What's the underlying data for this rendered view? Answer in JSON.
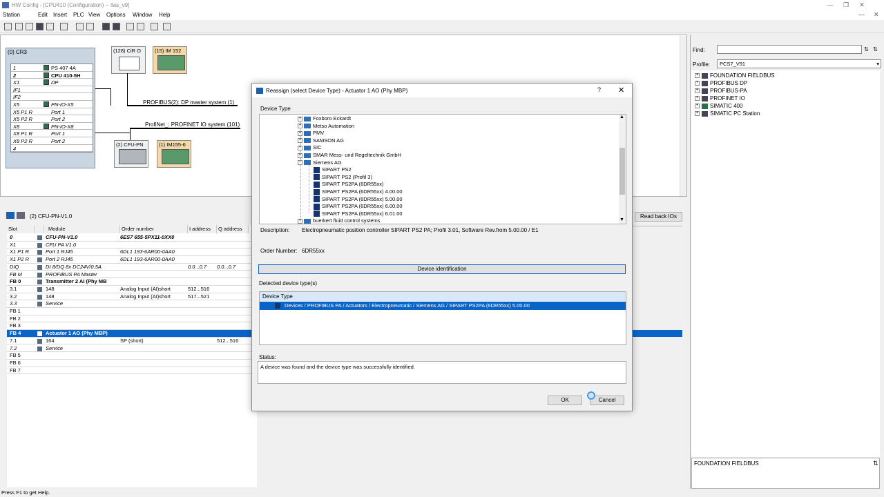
{
  "window": {
    "title": "HW Config - [CPU410 (Configuration) -- llas_v9]"
  },
  "menu": [
    "Station",
    "Edit",
    "Insert",
    "PLC",
    "View",
    "Options",
    "Window",
    "Help"
  ],
  "rack": {
    "title": "(0) CR3",
    "rows": [
      {
        "slot": "1",
        "module": "PS 407 4A"
      },
      {
        "slot": "2",
        "module": "CPU 410-5H"
      },
      {
        "slot": "X1",
        "module": "DP"
      },
      {
        "slot": "IF1",
        "module": ""
      },
      {
        "slot": "IF2",
        "module": ""
      },
      {
        "slot": "X5",
        "module": "PN-IO-X5"
      },
      {
        "slot": "X5 P1 R",
        "module": "Port 1"
      },
      {
        "slot": "X5 P2 R",
        "module": "Port 2"
      },
      {
        "slot": "X8",
        "module": "PN-IO-X8"
      },
      {
        "slot": "X8 P1 R",
        "module": "Port 1"
      },
      {
        "slot": "X8 P2 R",
        "module": "Port 2"
      },
      {
        "slot": "4",
        "module": ""
      }
    ]
  },
  "network": {
    "dev1": "(128) CiR O",
    "dev2": "(15) IM 152",
    "dev3": "(2) CFU-PN",
    "dev4": "(1) IM155-6",
    "profibus": "PROFIBUS(2): DP master system (1)",
    "profinet": "ProfiNet_: PROFINET IO system (101)"
  },
  "lower": {
    "title": "(2)   CFU-PN-V1.0",
    "headers": [
      "Slot",
      "",
      "Module",
      "Order number",
      "I address",
      "Q address"
    ],
    "rows": [
      {
        "slot": "0",
        "module": "CFU-PN-V1.0",
        "order": "6ES7 655-5PX11-0XX0",
        "i": "",
        "q": "",
        "style": "bi"
      },
      {
        "slot": "X1",
        "module": "CFU PA V1.0",
        "order": "",
        "i": "",
        "q": "",
        "style": "it"
      },
      {
        "slot": "X1 P1 R",
        "module": "Port 1 RJ45",
        "order": "6DL1 193-6AR00-0AA0",
        "i": "",
        "q": "",
        "style": "it"
      },
      {
        "slot": "X1 P2 R",
        "module": "Port 2 RJ45",
        "order": "6DL1 193-6AR00-0AA0",
        "i": "",
        "q": "",
        "style": "it"
      },
      {
        "slot": "DIQ",
        "module": "DI 8/DQ 8x DC24V/0.5A",
        "order": "",
        "i": "0.0...0.7",
        "q": "0.0...0.7",
        "style": "it"
      },
      {
        "slot": "FB M",
        "module": "PROFIBUS PA Master",
        "order": "",
        "i": "",
        "q": "",
        "style": "it"
      },
      {
        "slot": "FB 0",
        "module": "Transmitter 2 AI (Phy MB",
        "order": "",
        "i": "",
        "q": "",
        "style": "bd"
      },
      {
        "slot": "3.1",
        "module": "148",
        "order": "Analog Input (AI)short",
        "i": "512...516",
        "q": "",
        "style": ""
      },
      {
        "slot": "3.2",
        "module": "148",
        "order": "Analog Input (AI)short",
        "i": "517...521",
        "q": "",
        "style": ""
      },
      {
        "slot": "3.3",
        "module": "Service",
        "order": "",
        "i": "",
        "q": "",
        "style": "it"
      },
      {
        "slot": "FB 1",
        "module": "",
        "order": "",
        "i": "",
        "q": "",
        "style": ""
      },
      {
        "slot": "FB 2",
        "module": "",
        "order": "",
        "i": "",
        "q": "",
        "style": ""
      },
      {
        "slot": "FB 3",
        "module": "",
        "order": "",
        "i": "",
        "q": "",
        "style": ""
      },
      {
        "slot": "FB 4",
        "module": "Actuator 1 AO (Phy MBP)",
        "order": "",
        "i": "",
        "q": "",
        "style": "sel"
      },
      {
        "slot": "7.1",
        "module": "164",
        "order": "SP (short)",
        "i": "",
        "q": "512...516",
        "style": ""
      },
      {
        "slot": "7.2",
        "module": "Service",
        "order": "",
        "i": "",
        "q": "",
        "style": "it"
      },
      {
        "slot": "FB 5",
        "module": "",
        "order": "",
        "i": "",
        "q": "",
        "style": ""
      },
      {
        "slot": "FB 6",
        "module": "",
        "order": "",
        "i": "",
        "q": "",
        "style": ""
      },
      {
        "slot": "FB 7",
        "module": "",
        "order": "",
        "i": "",
        "q": "",
        "style": ""
      }
    ]
  },
  "readback_label": "Read back IOs",
  "catalog": {
    "find_label": "Find:",
    "profile_label": "Profile:",
    "profile_value": "PCS7_V91",
    "items": [
      "FOUNDATION FIELDBUS",
      "PROFIBUS DP",
      "PROFIBUS-PA",
      "PROFINET IO",
      "SIMATIC 400",
      "SIMATIC PC Station"
    ],
    "info": "FOUNDATION FIELDBUS"
  },
  "status_bar": "Press F1 to get Help.",
  "dialog": {
    "title": "Reassign (select Device Type) - Actuator 1 AO (Phy MBP)",
    "help": "?",
    "device_type_label": "Device Type",
    "tree": [
      {
        "label": "Foxboro Eckardt",
        "kind": "folder"
      },
      {
        "label": "Metso Automation",
        "kind": "folder"
      },
      {
        "label": "PMV",
        "kind": "folder"
      },
      {
        "label": "SAMSON AG",
        "kind": "folder"
      },
      {
        "label": "SIC",
        "kind": "folder"
      },
      {
        "label": "SMAR Mess- und Regeltechnik GmbH",
        "kind": "folder"
      },
      {
        "label": "Siemens AG",
        "kind": "open"
      },
      {
        "label": "SIPART PS2",
        "kind": "device"
      },
      {
        "label": "SIPART PS2 (Profil 3)",
        "kind": "device"
      },
      {
        "label": "SIPART PS2PA (6DR55xx)",
        "kind": "device"
      },
      {
        "label": "SIPART PS2PA (6DR55xx) 4.00.00",
        "kind": "device"
      },
      {
        "label": "SIPART PS2PA (6DR55xx) 5.00.00",
        "kind": "device"
      },
      {
        "label": "SIPART PS2PA (6DR55xx) 6.00.00",
        "kind": "device"
      },
      {
        "label": "SIPART PS2PA (6DR55xx) 6.01.00",
        "kind": "device"
      },
      {
        "label": "buerkert fluid control systems",
        "kind": "folder"
      }
    ],
    "description_label": "Description:",
    "description": "Electropneumatic position controller SIPART PS2 PA; Profil 3.01, Software Rev.from 5.00.00 / E1",
    "order_label": "Order Number:",
    "order": "6DR55xx",
    "identify_button": "Device identification",
    "detected_label": "Detected device type(s)",
    "detected_header": "Device Type",
    "detected_row": "Devices / PROFIBUS PA / Actuators / Electropneumatic / Siemens AG / SIPART PS2PA (6DR55xx) 5.00.00",
    "status_label": "Status:",
    "status_text": "A device was found and the device type was successfully identified.",
    "ok": "OK",
    "cancel": "Cancel"
  }
}
